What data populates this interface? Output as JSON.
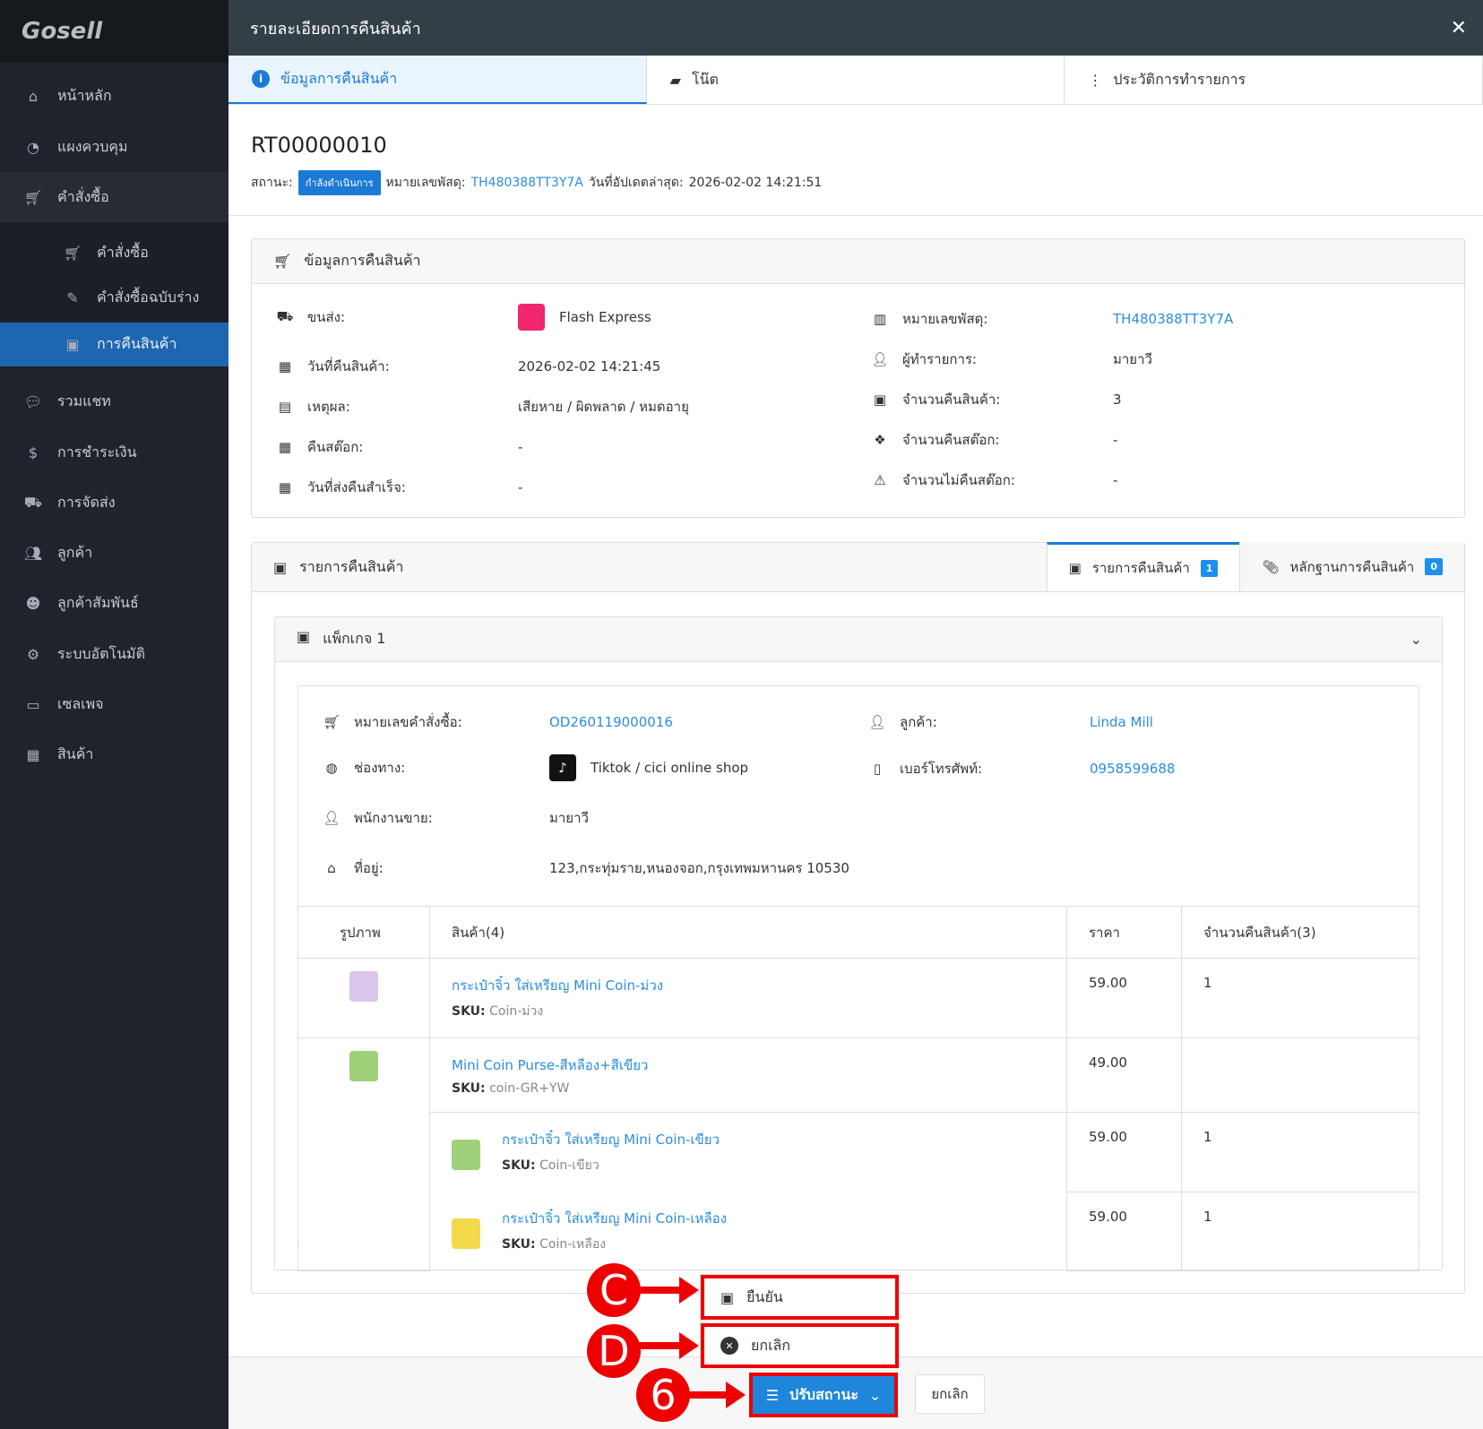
{
  "app": {
    "logo": "Gosell",
    "title": "รายละเอียดการคืนสินค้า"
  },
  "sidebar": {
    "items": [
      {
        "label": "หน้าหลัก",
        "icon": "home-icon"
      },
      {
        "label": "แผงควบคุม",
        "icon": "dashboard-icon"
      },
      {
        "label": "คำสั่งซื้อ",
        "icon": "cart-icon"
      },
      {
        "label": "คำสั่งซื้อ",
        "icon": "cart-icon"
      },
      {
        "label": "คำสั่งซื้อฉบับร่าง",
        "icon": "draft-icon"
      },
      {
        "label": "การคืนสินค้า",
        "icon": "return-icon"
      },
      {
        "label": "รวมแชท",
        "icon": "chat-icon"
      },
      {
        "label": "การชำระเงิน",
        "icon": "money-icon"
      },
      {
        "label": "การจัดส่ง",
        "icon": "truck-icon"
      },
      {
        "label": "ลูกค้า",
        "icon": "users-icon"
      },
      {
        "label": "ลูกค้าสัมพันธ์",
        "icon": "crm-icon"
      },
      {
        "label": "ระบบอัตโนมัติ",
        "icon": "robot-icon"
      },
      {
        "label": "เซลเพจ",
        "icon": "page-icon"
      },
      {
        "label": "สินค้า",
        "icon": "boxes-icon"
      }
    ]
  },
  "tabs": [
    "ข้อมูลการคืนสินค้า",
    "โน๊ต",
    "ประวัติการทำรายการ"
  ],
  "return": {
    "id": "RT00000010",
    "status_label": "สถานะ:",
    "status": "กำลังดำเนินการ",
    "tracking_label": "หมายเลขพัสดุ:",
    "tracking": "TH480388TT3Y7A",
    "updated_label": "วันที่อัปเดตล่าสุด:",
    "updated": "2026-02-02 14:21:51"
  },
  "info": {
    "title": "ข้อมูลการคืนสินค้า",
    "left": [
      {
        "label": "ขนส่ง:",
        "value": "Flash Express"
      },
      {
        "label": "วันที่คืนสินค้า:",
        "value": "2026-02-02 14:21:45"
      },
      {
        "label": "เหตุผล:",
        "value": "เสียหาย / ผิดพลาด / หมดอายุ"
      },
      {
        "label": "คืนสต๊อก:",
        "value": "-"
      },
      {
        "label": "วันที่ส่งคืนสำเร็จ:",
        "value": "-"
      }
    ],
    "right": [
      {
        "label": "หมายเลขพัสดุ:",
        "value": "TH480388TT3Y7A"
      },
      {
        "label": "ผู้ทำรายการ:",
        "value": "มายาวี"
      },
      {
        "label": "จำนวนคืนสินค้า:",
        "value": "3"
      },
      {
        "label": "จำนวนคืนสต๊อก:",
        "value": "-"
      },
      {
        "label": "จำนวนไม่คืนสต๊อก:",
        "value": "-"
      }
    ]
  },
  "items": {
    "title": "รายการคืนสินค้า",
    "tab1": "รายการคืนสินค้า",
    "tab1_count": "1",
    "tab2": "หลักฐานการคืนสินค้า",
    "tab2_count": "0",
    "package": "แพ็กเกจ 1",
    "order_label": "หมายเลขคำสั่งซื้อ:",
    "order": "OD260119000016",
    "customer_label": "ลูกค้า:",
    "customer": "Linda Mill",
    "channel_label": "ช่องทาง:",
    "channel": "Tiktok / cici online shop",
    "phone_label": "เบอร์โทรศัพท์:",
    "phone": "0958599688",
    "sales_label": "พนักงานขาย:",
    "sales": "มายาวี",
    "address_label": "ที่อยู่:",
    "address": "123,กระทุ่มราย,หนองจอก,กรุงเทพมหานคร 10530",
    "headers": [
      "รูปภาพ",
      "สินค้า(4)",
      "ราคา",
      "จำนวนคืนสินค้า(3)"
    ],
    "rows": [
      {
        "name": "กระเป๋าจิ๋ว ใส่เหรียญ Mini Coin-ม่วง",
        "sku_label": "SKU:",
        "sku": "Coin-ม่วง",
        "price": "59.00",
        "qty": "1"
      },
      {
        "name": "Mini Coin Purse-สีหลือง+สีเขียว",
        "sku_label": "SKU:",
        "sku": "coin-GR+YW",
        "price": "49.00",
        "qty": ""
      },
      {
        "name": "กระเป๋าจิ๋ว ใส่เหรียญ Mini Coin-เขียว",
        "sku_label": "SKU:",
        "sku": "Coin-เขียว",
        "price": "59.00",
        "qty": "1"
      },
      {
        "name": "กระเป๋าจิ๋ว ใส่เหรียญ Mini Coin-เหลือง",
        "sku_label": "SKU:",
        "sku": "Coin-เหลือง",
        "price": "59.00",
        "qty": "1"
      }
    ]
  },
  "footer": {
    "menu": [
      "ยืนยัน",
      "ยกเลิก"
    ],
    "update_status": "ปรับสถานะ",
    "cancel": "ยกเลิก"
  },
  "annotations": [
    "C",
    "D",
    "6"
  ]
}
